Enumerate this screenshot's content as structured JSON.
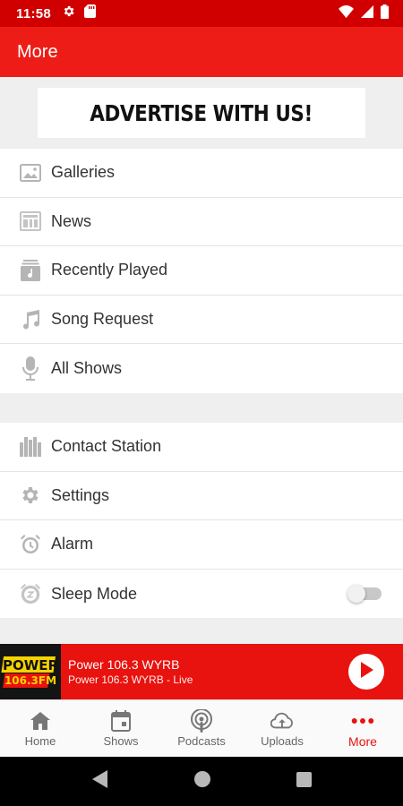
{
  "status_bar": {
    "time": "11:58",
    "icons": [
      "settings-icon",
      "sd-card-icon",
      "wifi-icon",
      "signal-icon",
      "battery-icon"
    ]
  },
  "app_bar": {
    "title": "More"
  },
  "ad_banner": {
    "text": "ADVERTISE WITH US!"
  },
  "menu": {
    "group1": [
      {
        "label": "Galleries",
        "icon": "gallery-icon"
      },
      {
        "label": "News",
        "icon": "news-icon"
      },
      {
        "label": "Recently Played",
        "icon": "recently-played-icon"
      },
      {
        "label": "Song Request",
        "icon": "music-note-icon"
      },
      {
        "label": "All Shows",
        "icon": "microphone-icon"
      }
    ],
    "group2": [
      {
        "label": "Contact Station",
        "icon": "building-icon"
      },
      {
        "label": "Settings",
        "icon": "gear-icon"
      },
      {
        "label": "Alarm",
        "icon": "alarm-icon"
      },
      {
        "label": "Sleep Mode",
        "icon": "sleep-icon",
        "toggle_on": false
      }
    ]
  },
  "player": {
    "title": "Power 106.3 WYRB",
    "subtitle": "Power 106.3 WYRB - Live",
    "logo_text": [
      "POWER",
      "106.3FM"
    ],
    "play_icon": "play-icon"
  },
  "bottom_nav": {
    "items": [
      {
        "label": "Home",
        "icon": "home-icon",
        "active": false
      },
      {
        "label": "Shows",
        "icon": "calendar-icon",
        "active": false
      },
      {
        "label": "Podcasts",
        "icon": "podcast-icon",
        "active": false
      },
      {
        "label": "Uploads",
        "icon": "upload-cloud-icon",
        "active": false
      },
      {
        "label": "More",
        "icon": "more-dots-icon",
        "active": true
      }
    ]
  },
  "colors": {
    "status_bar": "#d10000",
    "app_bar": "#ed1c16",
    "player": "#e8120e",
    "active_nav": "#e8120e",
    "icon_gray": "#b5b5b5"
  }
}
